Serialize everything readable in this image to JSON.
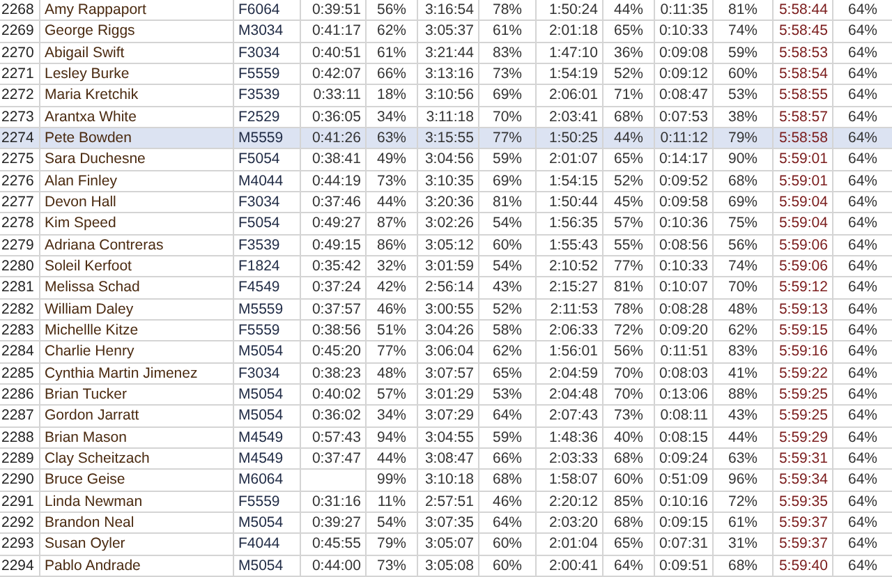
{
  "table": {
    "rows": [
      {
        "selected": false,
        "cells": [
          "2268",
          "Amy Rappaport",
          "F6064",
          "0:39:51",
          "56%",
          "3:16:54",
          "78%",
          "1:50:24",
          "44%",
          "0:11:35",
          "81%",
          "5:58:44",
          "64%"
        ]
      },
      {
        "selected": false,
        "cells": [
          "2269",
          "George Riggs",
          "M3034",
          "0:41:17",
          "62%",
          "3:05:37",
          "61%",
          "2:01:18",
          "65%",
          "0:10:33",
          "74%",
          "5:58:45",
          "64%"
        ]
      },
      {
        "selected": false,
        "cells": [
          "2270",
          "Abigail Swift",
          "F3034",
          "0:40:51",
          "61%",
          "3:21:44",
          "83%",
          "1:47:10",
          "36%",
          "0:09:08",
          "59%",
          "5:58:53",
          "64%"
        ]
      },
      {
        "selected": false,
        "cells": [
          "2271",
          "Lesley Burke",
          "F5559",
          "0:42:07",
          "66%",
          "3:13:16",
          "73%",
          "1:54:19",
          "52%",
          "0:09:12",
          "60%",
          "5:58:54",
          "64%"
        ]
      },
      {
        "selected": false,
        "cells": [
          "2272",
          "Maria Kretchik",
          "F3539",
          "0:33:11",
          "18%",
          "3:10:56",
          "69%",
          "2:06:01",
          "71%",
          "0:08:47",
          "53%",
          "5:58:55",
          "64%"
        ]
      },
      {
        "selected": false,
        "cells": [
          "2273",
          "Arantxa White",
          "F2529",
          "0:36:05",
          "34%",
          "3:11:18",
          "70%",
          "2:03:41",
          "68%",
          "0:07:53",
          "38%",
          "5:58:57",
          "64%"
        ]
      },
      {
        "selected": true,
        "cells": [
          "2274",
          "Pete Bowden",
          "M5559",
          "0:41:26",
          "63%",
          "3:15:55",
          "77%",
          "1:50:25",
          "44%",
          "0:11:12",
          "79%",
          "5:58:58",
          "64%"
        ]
      },
      {
        "selected": false,
        "cells": [
          "2275",
          "Sara Duchesne",
          "F5054",
          "0:38:41",
          "49%",
          "3:04:56",
          "59%",
          "2:01:07",
          "65%",
          "0:14:17",
          "90%",
          "5:59:01",
          "64%"
        ]
      },
      {
        "selected": false,
        "cells": [
          "2276",
          "Alan Finley",
          "M4044",
          "0:44:19",
          "73%",
          "3:10:35",
          "69%",
          "1:54:15",
          "52%",
          "0:09:52",
          "68%",
          "5:59:01",
          "64%"
        ]
      },
      {
        "selected": false,
        "cells": [
          "2277",
          "Devon Hall",
          "F3034",
          "0:37:46",
          "44%",
          "3:20:36",
          "81%",
          "1:50:44",
          "45%",
          "0:09:58",
          "69%",
          "5:59:04",
          "64%"
        ]
      },
      {
        "selected": false,
        "cells": [
          "2278",
          "Kim Speed",
          "F5054",
          "0:49:27",
          "87%",
          "3:02:26",
          "54%",
          "1:56:35",
          "57%",
          "0:10:36",
          "75%",
          "5:59:04",
          "64%"
        ]
      },
      {
        "selected": false,
        "cells": [
          "2279",
          "Adriana Contreras",
          "F3539",
          "0:49:15",
          "86%",
          "3:05:12",
          "60%",
          "1:55:43",
          "55%",
          "0:08:56",
          "56%",
          "5:59:06",
          "64%"
        ]
      },
      {
        "selected": false,
        "cells": [
          "2280",
          "Soleil Kerfoot",
          "F1824",
          "0:35:42",
          "32%",
          "3:01:59",
          "54%",
          "2:10:52",
          "77%",
          "0:10:33",
          "74%",
          "5:59:06",
          "64%"
        ]
      },
      {
        "selected": false,
        "cells": [
          "2281",
          "Melissa Schad",
          "F4549",
          "0:37:24",
          "42%",
          "2:56:14",
          "43%",
          "2:15:27",
          "81%",
          "0:10:07",
          "70%",
          "5:59:12",
          "64%"
        ]
      },
      {
        "selected": false,
        "cells": [
          "2282",
          "William Daley",
          "M5559",
          "0:37:57",
          "46%",
          "3:00:55",
          "52%",
          "2:11:53",
          "78%",
          "0:08:28",
          "48%",
          "5:59:13",
          "64%"
        ]
      },
      {
        "selected": false,
        "cells": [
          "2283",
          "Michellle Kitze",
          "F5559",
          "0:38:56",
          "51%",
          "3:04:26",
          "58%",
          "2:06:33",
          "72%",
          "0:09:20",
          "62%",
          "5:59:15",
          "64%"
        ]
      },
      {
        "selected": false,
        "cells": [
          "2284",
          "Charlie Henry",
          "M5054",
          "0:45:20",
          "77%",
          "3:06:04",
          "62%",
          "1:56:01",
          "56%",
          "0:11:51",
          "83%",
          "5:59:16",
          "64%"
        ]
      },
      {
        "selected": false,
        "cells": [
          "2285",
          "Cynthia Martin Jimenez",
          "F3034",
          "0:38:23",
          "48%",
          "3:07:57",
          "65%",
          "2:04:59",
          "70%",
          "0:08:03",
          "41%",
          "5:59:22",
          "64%"
        ]
      },
      {
        "selected": false,
        "cells": [
          "2286",
          "Brian Tucker",
          "M5054",
          "0:40:02",
          "57%",
          "3:01:29",
          "53%",
          "2:04:48",
          "70%",
          "0:13:06",
          "88%",
          "5:59:25",
          "64%"
        ]
      },
      {
        "selected": false,
        "cells": [
          "2287",
          "Gordon Jarratt",
          "M5054",
          "0:36:02",
          "34%",
          "3:07:29",
          "64%",
          "2:07:43",
          "73%",
          "0:08:11",
          "43%",
          "5:59:25",
          "64%"
        ]
      },
      {
        "selected": false,
        "cells": [
          "2288",
          "Brian Mason",
          "M4549",
          "0:57:43",
          "94%",
          "3:04:55",
          "59%",
          "1:48:36",
          "40%",
          "0:08:15",
          "44%",
          "5:59:29",
          "64%"
        ]
      },
      {
        "selected": false,
        "cells": [
          "2289",
          "Clay Scheitzach",
          "M4549",
          "0:37:47",
          "44%",
          "3:08:47",
          "66%",
          "2:03:33",
          "68%",
          "0:09:24",
          "63%",
          "5:59:31",
          "64%"
        ]
      },
      {
        "selected": false,
        "cells": [
          "2290",
          "Bruce Geise",
          "M6064",
          null,
          "99%",
          "3:10:18",
          "68%",
          "1:58:07",
          "60%",
          "0:51:09",
          "96%",
          "5:59:34",
          "64%"
        ]
      },
      {
        "selected": false,
        "cells": [
          "2291",
          "Linda Newman",
          "F5559",
          "0:31:16",
          "11%",
          "2:57:51",
          "46%",
          "2:20:12",
          "85%",
          "0:10:16",
          "72%",
          "5:59:35",
          "64%"
        ]
      },
      {
        "selected": false,
        "cells": [
          "2292",
          "Brandon Neal",
          "M5054",
          "0:39:27",
          "54%",
          "3:07:35",
          "64%",
          "2:03:20",
          "68%",
          "0:09:15",
          "61%",
          "5:59:37",
          "64%"
        ]
      },
      {
        "selected": false,
        "cells": [
          "2293",
          "Susan Oyler",
          "F4044",
          "0:45:55",
          "79%",
          "3:05:07",
          "60%",
          "2:01:04",
          "65%",
          "0:07:31",
          "31%",
          "5:59:37",
          "64%"
        ]
      },
      {
        "selected": false,
        "cells": [
          "2294",
          "Pablo Andrade",
          "M5054",
          "0:44:00",
          "73%",
          "3:05:08",
          "60%",
          "2:00:41",
          "64%",
          "0:09:51",
          "68%",
          "5:59:40",
          "64%"
        ]
      }
    ]
  }
}
